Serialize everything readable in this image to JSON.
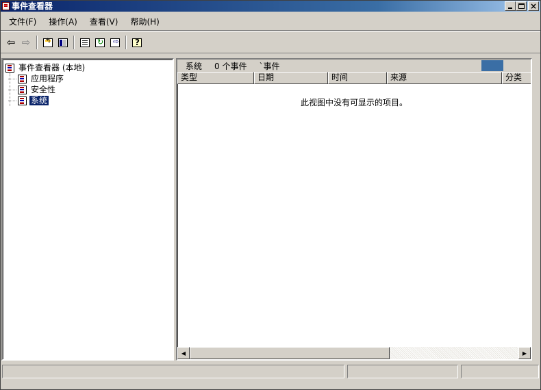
{
  "window": {
    "title": "事件查看器",
    "controls": {
      "minimize": "_",
      "maximize": "□",
      "close": "×"
    }
  },
  "menu": {
    "items": [
      "文件(F)",
      "操作(A)",
      "查看(V)",
      "帮助(H)"
    ]
  },
  "toolbar": {
    "icons": [
      "back-arrow-icon",
      "forward-arrow-icon",
      "up-folder-icon",
      "show-hide-tree-icon",
      "properties-icon",
      "refresh-icon",
      "export-list-icon",
      "help-icon"
    ],
    "back_glyph": "⇦",
    "forward_glyph": "⇨"
  },
  "tree": {
    "root": "事件查看器 (本地)",
    "children": [
      {
        "label": "应用程序",
        "selected": false
      },
      {
        "label": "安全性",
        "selected": false
      },
      {
        "label": "系统",
        "selected": true
      }
    ]
  },
  "pane": {
    "header_log": "系统",
    "header_count": "0 个事件",
    "header_extra": "`事件",
    "columns": [
      "类型",
      "日期",
      "时间",
      "来源",
      "分类"
    ],
    "empty_message": "此视图中没有可显示的项目。"
  },
  "colors": {
    "title_gradient_start": "#0a246a",
    "selection": "#0a246a",
    "chrome": "#d4d0c8"
  }
}
